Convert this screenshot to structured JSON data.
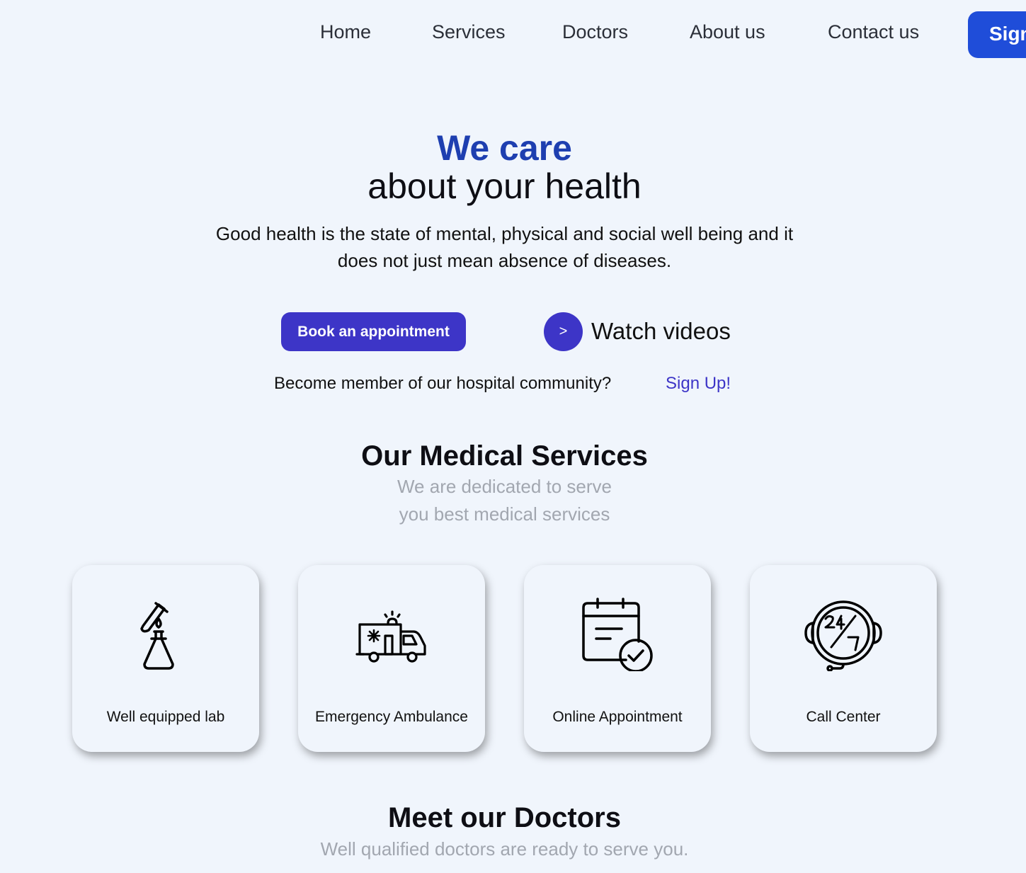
{
  "nav": {
    "items": [
      {
        "label": "Home"
      },
      {
        "label": "Services"
      },
      {
        "label": "Doctors"
      },
      {
        "label": "About us"
      },
      {
        "label": "Contact us"
      }
    ],
    "signin_label": "Sign"
  },
  "hero": {
    "title_highlight": "We care",
    "title_rest": "about your health",
    "description": "Good health is the state of mental, physical and social well being and it does not just mean absence of diseases.",
    "book_label": "Book an appointment",
    "play_symbol": ">",
    "watch_label": "Watch videos",
    "member_text": "Become member of our hospital community?",
    "signup_label": "Sign Up!"
  },
  "services": {
    "title": "Our Medical Services",
    "subtitle_line1": "We are dedicated to serve",
    "subtitle_line2": "you best medical services",
    "cards": [
      {
        "label": "Well equipped lab",
        "icon": "lab-flask-icon"
      },
      {
        "label": "Emergency Ambulance",
        "icon": "ambulance-icon"
      },
      {
        "label": "Online Appointment",
        "icon": "calendar-check-icon"
      },
      {
        "label": "Call Center",
        "icon": "headset-24-7-icon"
      }
    ]
  },
  "doctors": {
    "title": "Meet our Doctors",
    "subtitle": "Well qualified doctors are ready to serve you."
  },
  "colors": {
    "background": "#f0f5fc",
    "primary": "#3d35c7",
    "nav_button": "#1f4dd9",
    "title_blue": "#1e3fb0",
    "muted": "#a2a7b0"
  }
}
